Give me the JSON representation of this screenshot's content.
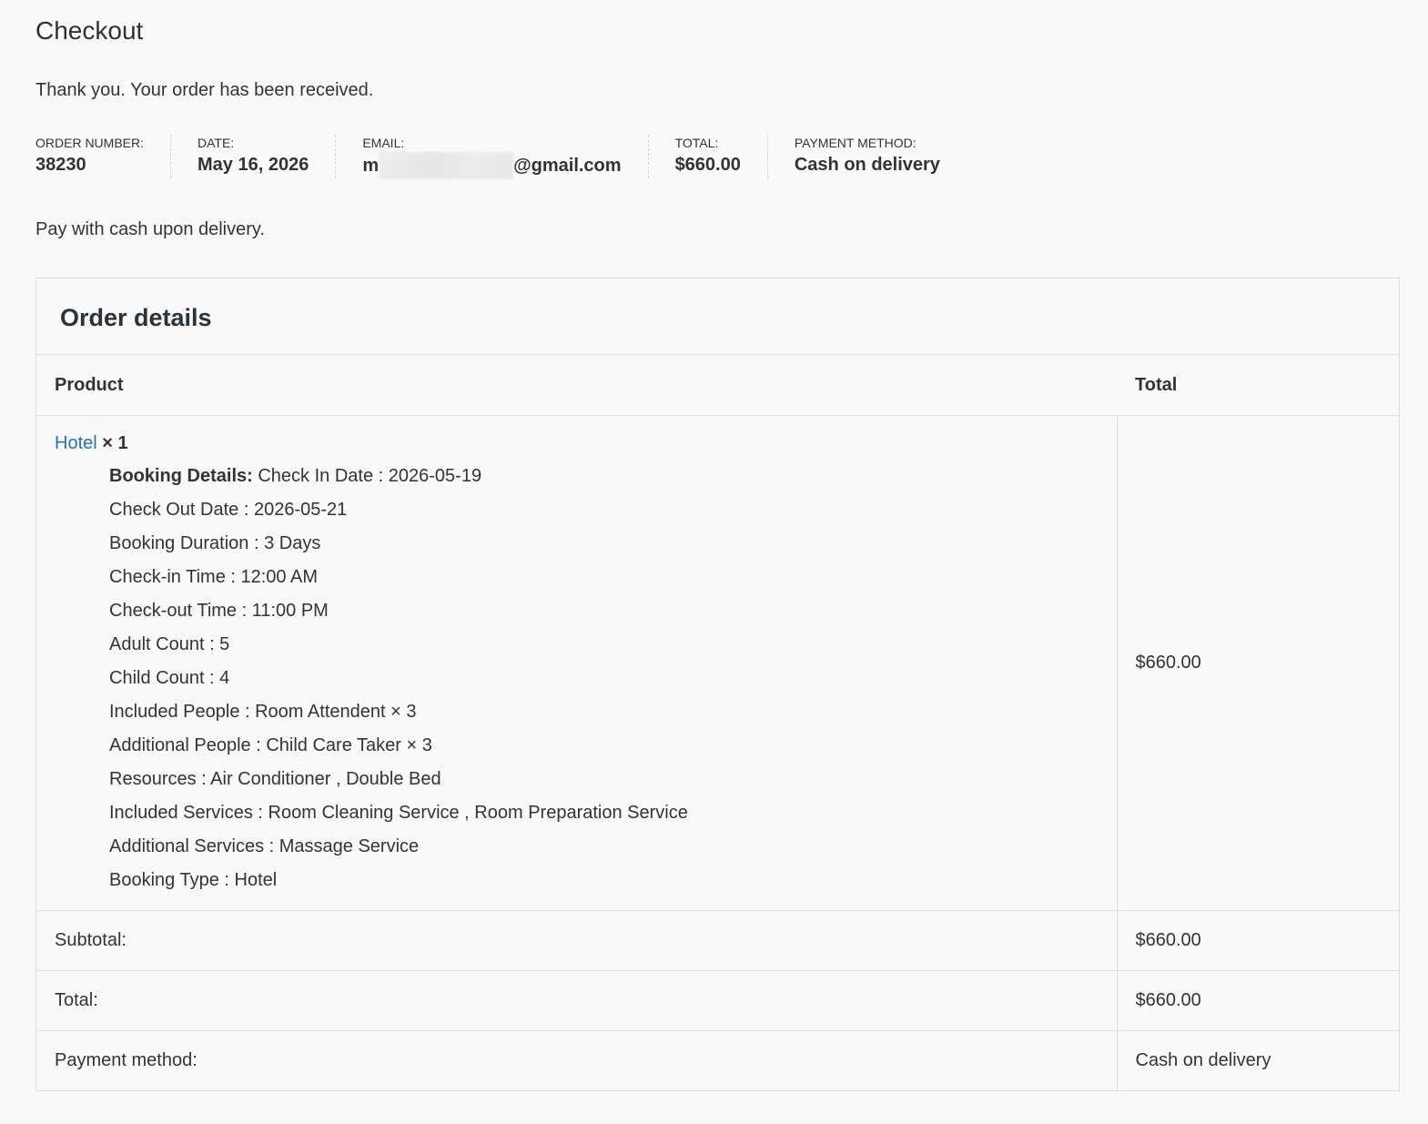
{
  "page": {
    "title": "Checkout",
    "thank_you": "Thank you. Your order has been received.",
    "payment_note": "Pay with cash upon delivery."
  },
  "overview": {
    "order_number_label": "Order number:",
    "order_number": "38230",
    "date_label": "Date:",
    "date": "May 16, 2026",
    "email_label": "Email:",
    "email_prefix": "m",
    "email_suffix": "@gmail.com",
    "total_label": "Total:",
    "total": "$660.00",
    "payment_label": "Payment method:",
    "payment": "Cash on delivery"
  },
  "order_details": {
    "heading": "Order details",
    "col_product": "Product",
    "col_total": "Total",
    "item": {
      "name": "Hotel",
      "qty": "× 1",
      "total": "$660.00",
      "booking_details_label": "Booking Details:",
      "meta": [
        "Check In Date : 2026-05-19",
        "Check Out Date : 2026-05-21",
        "Booking Duration : 3 Days",
        "Check-in Time : 12:00 AM",
        "Check-out Time : 11:00 PM",
        "Adult Count : 5",
        "Child Count : 4",
        "Included People : Room Attendent × 3",
        "Additional People : Child Care Taker × 3",
        "Resources : Air Conditioner , Double Bed",
        "Included Services : Room Cleaning Service , Room Preparation Service",
        "Additional Services : Massage Service",
        "Booking Type : Hotel"
      ]
    },
    "subtotal_label": "Subtotal:",
    "subtotal": "$660.00",
    "total_label": "Total:",
    "total": "$660.00",
    "payment_label": "Payment method:",
    "payment": "Cash on delivery"
  }
}
